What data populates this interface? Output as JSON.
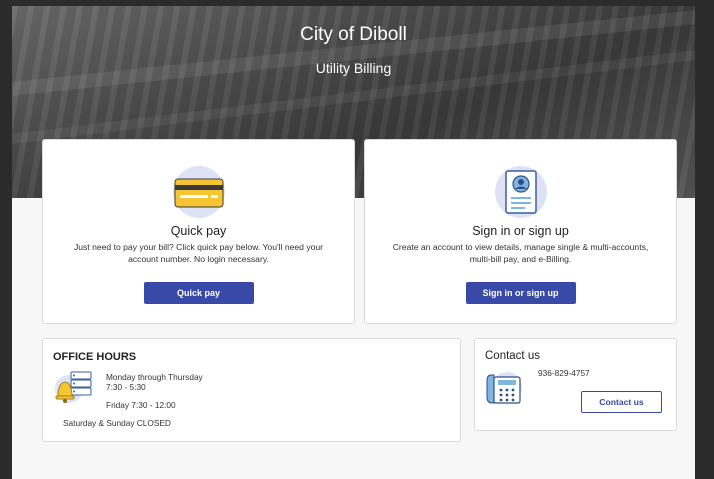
{
  "header": {
    "title": "City of Diboll",
    "subtitle": "Utility Billing"
  },
  "quick_pay": {
    "icon": "credit-card-icon",
    "title": "Quick pay",
    "description": "Just need to pay your bill? Click quick pay below. You'll need your account number. No login necessary.",
    "button_label": "Quick pay"
  },
  "sign_in": {
    "icon": "user-profile-document-icon",
    "title": "Sign in or sign up",
    "description": "Create an account to view details, manage single & multi-accounts, multi-bill pay, and e-Billing.",
    "button_label": "Sign in or sign up"
  },
  "office_hours": {
    "title": "OFFICE HOURS",
    "icon": "bell-server-icon",
    "weekdays_label": "Monday through Thursday",
    "weekdays_hours": "7:30 - 5:30",
    "friday": "Friday 7:30 - 12:00",
    "weekend": "Saturday & Sunday CLOSED"
  },
  "contact": {
    "title": "Contact us",
    "icon": "desk-phone-icon",
    "phone": "936-829-4757",
    "button_label": "Contact us"
  },
  "colors": {
    "primary": "#3949a8",
    "card_icon_bg": "#dde3f4",
    "card_yellow": "#f7c531"
  }
}
